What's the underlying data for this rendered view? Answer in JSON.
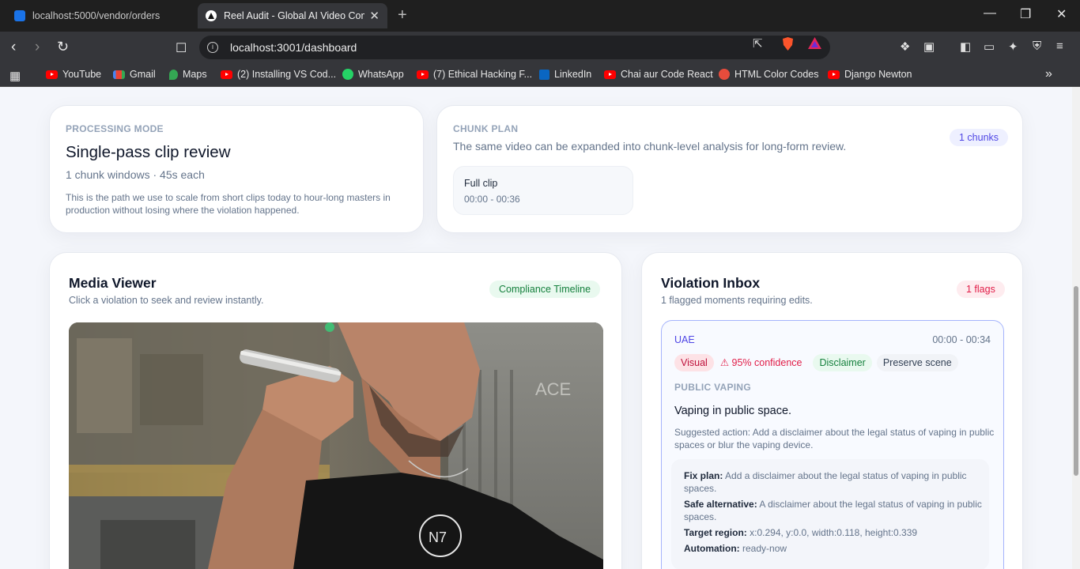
{
  "browser": {
    "tabs": [
      {
        "title": "localhost:5000/vendor/orders",
        "active": false
      },
      {
        "title": "Reel Audit - Global AI Video Com",
        "active": true
      }
    ],
    "url": "localhost:3001/dashboard",
    "bookmarks": [
      {
        "label": "YouTube",
        "icon": "youtube-icon"
      },
      {
        "label": "Gmail",
        "icon": "gmail-icon"
      },
      {
        "label": "Maps",
        "icon": "maps-icon"
      },
      {
        "label": "(2) Installing VS Cod...",
        "icon": "youtube-icon"
      },
      {
        "label": "WhatsApp",
        "icon": "whatsapp-icon"
      },
      {
        "label": "(7) Ethical Hacking F...",
        "icon": "youtube-icon"
      },
      {
        "label": "LinkedIn",
        "icon": "linkedin-icon"
      },
      {
        "label": "Chai aur Code React",
        "icon": "youtube-icon"
      },
      {
        "label": "HTML Color Codes",
        "icon": "html-color-codes-icon"
      },
      {
        "label": "Django Newton",
        "icon": "youtube-icon"
      }
    ]
  },
  "processing_mode": {
    "eyebrow": "PROCESSING MODE",
    "title": "Single-pass clip review",
    "subtitle": "1 chunk windows · 45s each",
    "description": "This is the path we use to scale from short clips today to hour-long masters in production without losing where the violation happened."
  },
  "chunk_plan": {
    "eyebrow": "CHUNK PLAN",
    "description": "The same video can be expanded into chunk-level analysis for long-form review.",
    "badge": "1 chunks",
    "chunks": [
      {
        "title": "Full clip",
        "range": "00:00 - 00:36"
      }
    ]
  },
  "media_viewer": {
    "title": "Media Viewer",
    "subtitle": "Click a violation to seek and review instantly.",
    "badge": "Compliance Timeline"
  },
  "violation_inbox": {
    "title": "Violation Inbox",
    "subtitle": "1 flagged moments requiring edits.",
    "badge": "1 flags",
    "items": [
      {
        "region": "UAE",
        "range": "00:00 - 00:34",
        "type_tag": "Visual",
        "confidence": "95% confidence",
        "fix_tag": "Disclaimer",
        "mode_tag": "Preserve scene",
        "category": "PUBLIC VAPING",
        "summary": "Vaping in public space.",
        "suggested_action": "Suggested action: Add a disclaimer about the legal status of vaping in public spaces or blur the vaping device.",
        "details": {
          "fix_plan_label": "Fix plan:",
          "fix_plan": "Add a disclaimer about the legal status of vaping in public spaces.",
          "safe_alternative_label": "Safe alternative:",
          "safe_alternative": "A disclaimer about the legal status of vaping in public spaces.",
          "target_region_label": "Target region:",
          "target_region": "x:0.294, y:0.0, width:0.118, height:0.339",
          "automation_label": "Automation:",
          "automation": "ready-now"
        }
      }
    ]
  },
  "colors": {
    "accent": "#4f46e5",
    "danger": "#e11d48",
    "success": "#15803d",
    "page_bg": "#f4f6fb"
  }
}
